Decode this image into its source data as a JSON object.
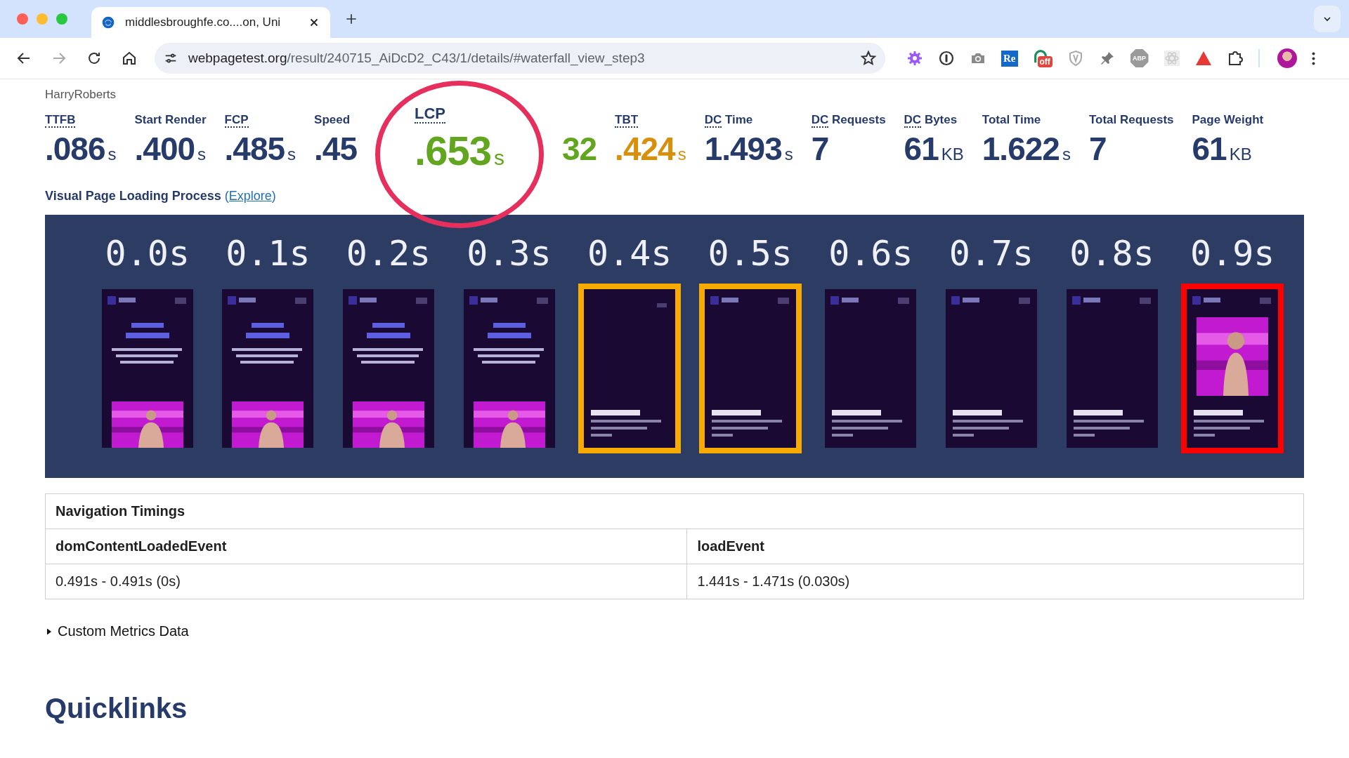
{
  "browser": {
    "tab": {
      "title": "middlesbroughfe.co....on, Uni"
    },
    "url": {
      "host": "webpagetest.org",
      "path": "/result/240715_AiDcD2_C43/1/details/#waterfall_view_step3"
    },
    "extensions": [
      {
        "kind": "gear"
      },
      {
        "kind": "keyhole"
      },
      {
        "kind": "camera"
      },
      {
        "kind": "text-badge",
        "text": "Re"
      },
      {
        "kind": "off-badge",
        "text": "off"
      },
      {
        "kind": "shield"
      },
      {
        "kind": "pin"
      },
      {
        "kind": "octagon",
        "text": "ABP"
      },
      {
        "kind": "atom"
      },
      {
        "kind": "triangle"
      },
      {
        "kind": "puzzle"
      }
    ]
  },
  "page": {
    "author": "HarryRoberts",
    "metrics": [
      {
        "abbr": "TTFB",
        "value": ".086",
        "unit": "s",
        "color": "#273b6b"
      },
      {
        "label": "Start Render",
        "value": ".400",
        "unit": "s",
        "color": "#273b6b"
      },
      {
        "abbr": "FCP",
        "value": ".485",
        "unit": "s",
        "color": "#273b6b"
      },
      {
        "label": "Speed",
        "value": ".45",
        "color": "#273b6b"
      },
      {
        "abbr": "LCP",
        "value": ".653",
        "unit": "s",
        "color": "#62a51f",
        "circled": true
      },
      {
        "value": "32",
        "color": "#62a51f"
      },
      {
        "abbr": "TBT",
        "value": ".424",
        "unit": "s",
        "color": "#d8900c"
      },
      {
        "abbr": "DC",
        "label": "Time",
        "value": "1.493",
        "unit": "s",
        "color": "#273b6b"
      },
      {
        "abbr": "DC",
        "label": "Requests",
        "value": "7",
        "color": "#273b6b"
      },
      {
        "abbr": "DC",
        "label": "Bytes",
        "value": "61",
        "unit": "KB",
        "color": "#273b6b"
      },
      {
        "label": "Total Time",
        "value": "1.622",
        "unit": "s",
        "color": "#273b6b"
      },
      {
        "label": "Total Requests",
        "value": "7",
        "color": "#273b6b"
      },
      {
        "label": "Page Weight",
        "value": "61",
        "unit": "KB",
        "color": "#273b6b"
      }
    ],
    "filmstrip": {
      "title": "Visual Page Loading Process",
      "link_open": "(",
      "link": "Explore",
      "link_close": ")",
      "frames": [
        {
          "time": "0.0s",
          "kind": "speakers"
        },
        {
          "time": "0.1s",
          "kind": "speakers"
        },
        {
          "time": "0.2s",
          "kind": "speakers"
        },
        {
          "time": "0.3s",
          "kind": "speakers"
        },
        {
          "time": "0.4s",
          "kind": "name-only",
          "color": "#f7ab00"
        },
        {
          "time": "0.5s",
          "kind": "name",
          "color": "#f7ab00"
        },
        {
          "time": "0.6s",
          "kind": "name"
        },
        {
          "time": "0.7s",
          "kind": "name"
        },
        {
          "time": "0.8s",
          "kind": "name"
        },
        {
          "time": "0.9s",
          "color": "#ff0000"
        }
      ]
    },
    "navigation_timings": {
      "title": "Navigation Timings",
      "columns": [
        "domContentLoadedEvent",
        "loadEvent"
      ],
      "rows": [
        [
          "0.491s - 0.491s (0s)",
          "1.441s - 1.471s (0.030s)"
        ]
      ]
    },
    "custom_metrics": {
      "label": "Custom Metrics Data",
      "expanded": false
    },
    "quicklinks": {
      "title": "Quicklinks"
    }
  }
}
